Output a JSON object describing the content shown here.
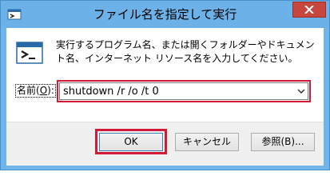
{
  "window": {
    "title": "ファイル名を指定して実行"
  },
  "dialog": {
    "description": "実行するプログラム名、または開くフォルダーやドキュメント名、インターネット リソース名を入力してください。",
    "name_label": "名前(",
    "name_label_accel": "O",
    "name_label_end": "):",
    "input_value": "shutdown /r /o /t 0"
  },
  "buttons": {
    "ok": "OK",
    "cancel": "キャンセル",
    "browse": "参照(B)..."
  },
  "icons": {
    "app": "run-icon",
    "close": "close-icon",
    "dropdown": "chevron-down-icon"
  },
  "colors": {
    "highlight": "#d11a38",
    "title_bar": "#6cb2e8",
    "close_button": "#c7463e"
  }
}
